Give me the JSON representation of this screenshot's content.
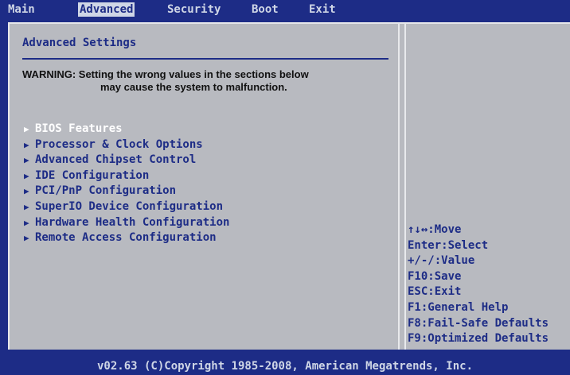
{
  "menubar": {
    "tabs": [
      "Main",
      "Advanced",
      "Security",
      "Boot",
      "Exit"
    ],
    "active": "Advanced"
  },
  "panel": {
    "title": "Advanced Settings",
    "warning_line1": "WARNING: Setting the wrong values in the sections below",
    "warning_line2": "may cause the system to malfunction.",
    "items": [
      "BIOS Features",
      "Processor & Clock Options",
      "Advanced Chipset Control",
      "IDE Configuration",
      "PCI/PnP Configuration",
      "SuperIO Device Configuration",
      "Hardware Health Configuration",
      "Remote Access Configuration"
    ],
    "selected_item": "BIOS Features"
  },
  "help": [
    "↑↓↔:Move",
    "Enter:Select",
    "+/-/:Value",
    "F10:Save",
    "ESC:Exit",
    "F1:General Help",
    "F8:Fail-Safe Defaults",
    "F9:Optimized Defaults"
  ],
  "footer": {
    "copyright": "v02.63 (C)Copyright 1985-2008, American Megatrends, Inc."
  },
  "colors": {
    "background": "#1d2c86",
    "panel": "#b8bac0",
    "text": "#1d2c86",
    "selected": "#ffffff"
  }
}
